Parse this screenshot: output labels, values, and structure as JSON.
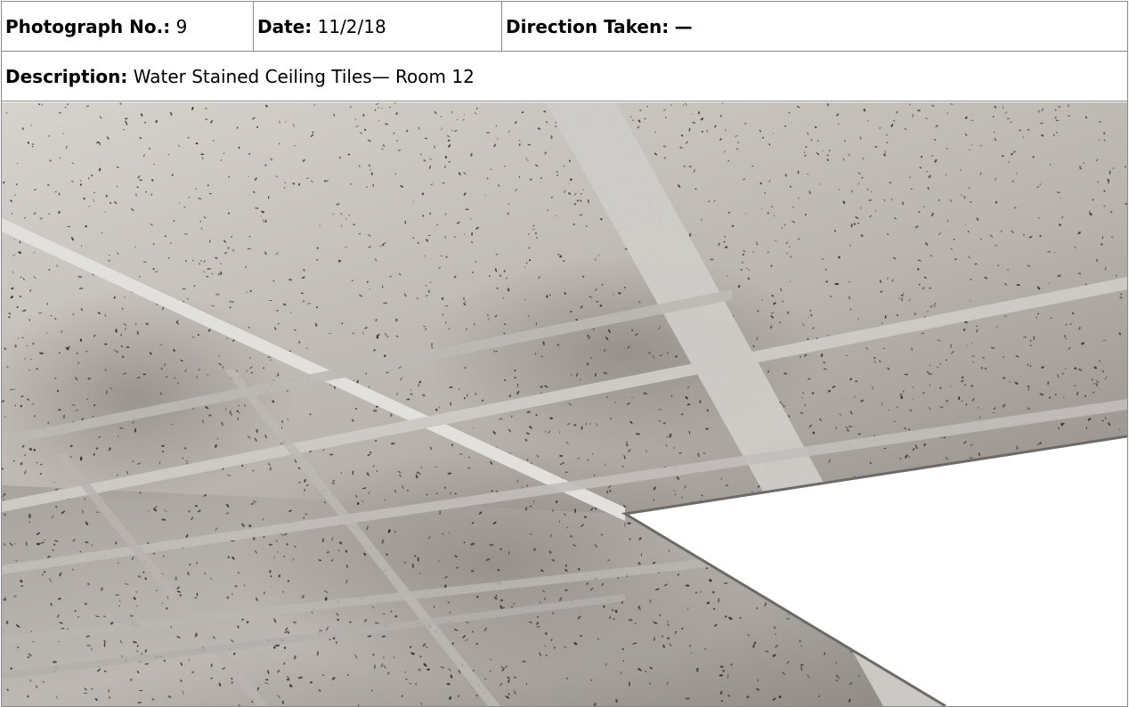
{
  "header": {
    "photo_no_label": "Photograph No.:",
    "photo_no_value": "9",
    "date_label": "Date:",
    "date_value": "11/2/18",
    "direction_label": "Direction Taken:",
    "direction_value": "—"
  },
  "description": {
    "label": "Description:",
    "value": "Water Stained Ceiling Tiles— Room 12"
  },
  "colors": {
    "border": "#8a8a8a",
    "tile_light": "#c9c5c1",
    "tile_dark": "#6f6a66",
    "speckle": "#2c2826",
    "grid": "#d8d6d3",
    "window": "#ffffff"
  }
}
